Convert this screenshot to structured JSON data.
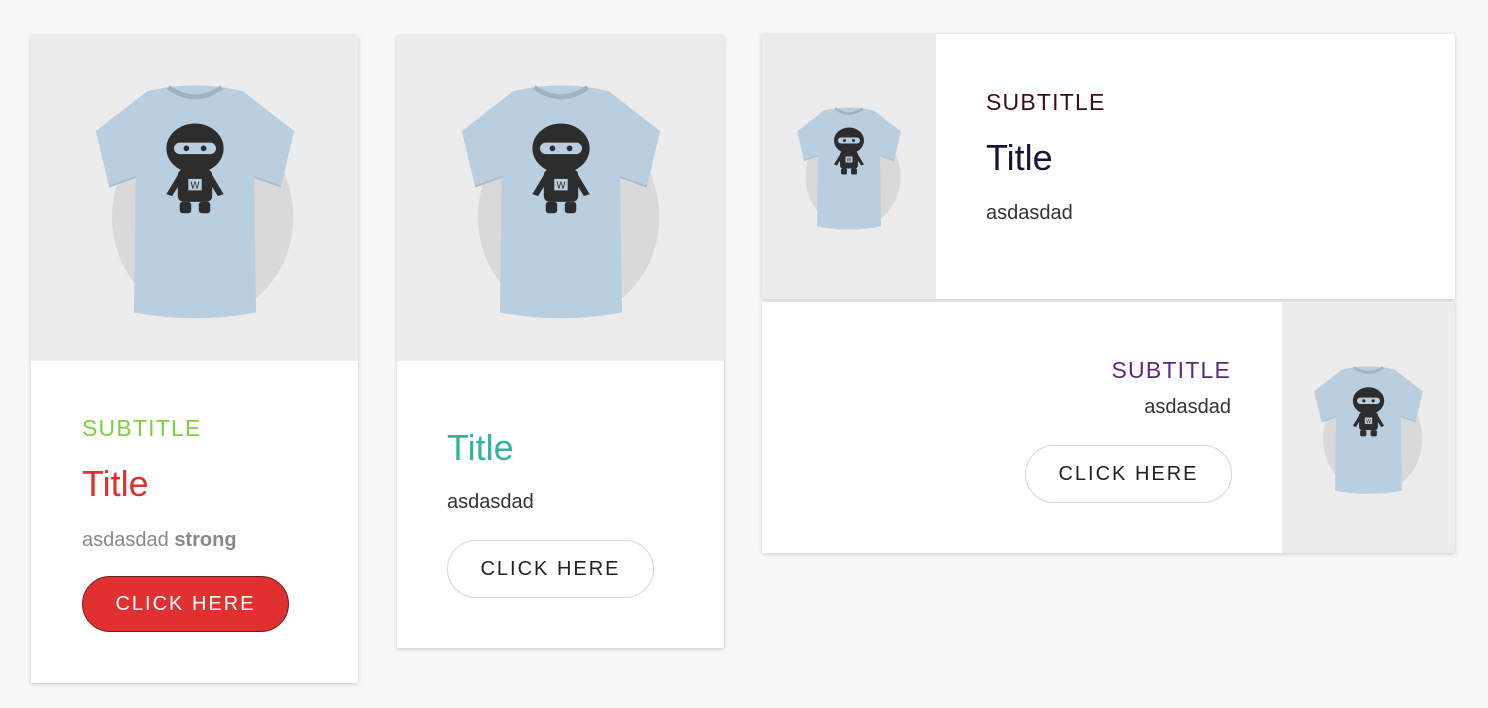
{
  "colors": {
    "page_bg": "#f7f7f7",
    "media_bg": "#ececec",
    "card1_subtitle": "#7fcf3a",
    "card1_title": "#e03030",
    "card1_button_bg": "#e03030",
    "card2_title": "#2fb5a0",
    "card3_subtitle": "#3a0f1c",
    "card3_title": "#141838",
    "card4_subtitle": "#5d2a7a",
    "shirt": "#b9cfe0",
    "ninja": "#2d2d2d"
  },
  "card1": {
    "image_alt": "t-shirt with ninja graphic",
    "subtitle": "SUBTITLE",
    "title": "Title",
    "text": "asdasdad",
    "text_strong": "strong",
    "button": "CLICK HERE"
  },
  "card2": {
    "image_alt": "t-shirt with ninja graphic",
    "title": "Title",
    "text": "asdasdad",
    "button": "CLICK HERE"
  },
  "card3": {
    "image_alt": "t-shirt with ninja graphic",
    "subtitle": "SUBTITLE",
    "title": "Title",
    "text": "asdasdad"
  },
  "card4": {
    "image_alt": "t-shirt with ninja graphic",
    "subtitle": "SUBTITLE",
    "text": "asdasdad",
    "button": "CLICK HERE"
  }
}
